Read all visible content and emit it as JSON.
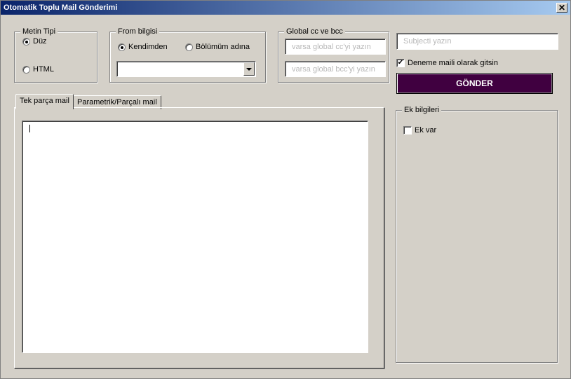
{
  "window": {
    "title": "Otomatik Toplu Mail Gönderimi",
    "close_label": "✕"
  },
  "metin_tipi": {
    "title": "Metin Tipi",
    "options": [
      {
        "label": "Düz",
        "checked": true
      },
      {
        "label": "HTML",
        "checked": false
      }
    ]
  },
  "from_bilgisi": {
    "title": "From bilgisi",
    "options": [
      {
        "label": "Kendimden",
        "checked": true
      },
      {
        "label": "Bölümüm adına",
        "checked": false
      }
    ],
    "dropdown_value": ""
  },
  "global_cc_bcc": {
    "title": "Global cc ve bcc",
    "cc_placeholder": "varsa global cc'yi yazın",
    "bcc_placeholder": "varsa global bcc'yi yazın"
  },
  "subject": {
    "placeholder": "Subjecti yazın"
  },
  "deneme_checkbox": {
    "label": "Deneme maili olarak gitsin",
    "checked": true
  },
  "send_button": {
    "label": "GÖNDER",
    "color": "#400040"
  },
  "tabs": [
    {
      "label": "Tek parça mail",
      "active": true
    },
    {
      "label": "Parametrik/Parçalı mail",
      "active": false
    }
  ],
  "body_text": "",
  "ek_bilgileri": {
    "title": "Ek bilgileri",
    "checkbox_label": "Ek var",
    "checked": false
  },
  "colors": {
    "dialog_bg": "#d4d0c8",
    "titlebar_start": "#0a246a",
    "titlebar_end": "#a6caf0"
  }
}
